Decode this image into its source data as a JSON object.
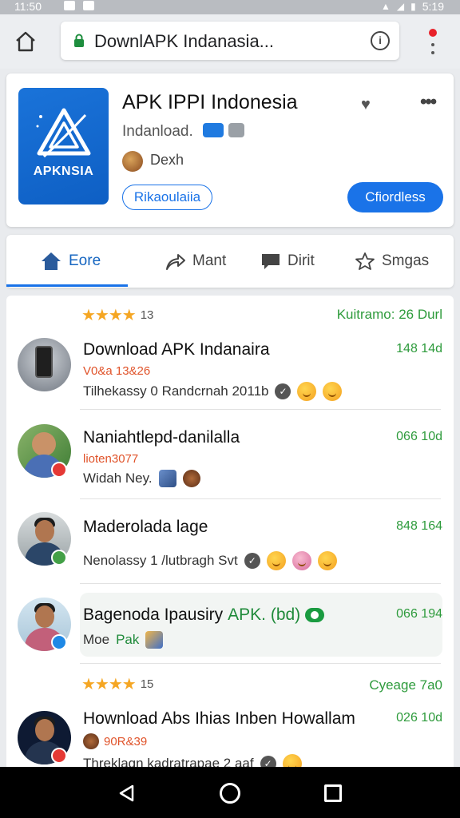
{
  "status_bar": {
    "time": "11:50",
    "right_time": "5:19"
  },
  "browser": {
    "url": "DownlAPK Indanasia..."
  },
  "app": {
    "title": "APK IPPI Indonesia",
    "logo_text": "APKNSIA",
    "subtitle": "Indanload.",
    "developer": "Dexh",
    "outline_button": "Rikaoulaiia",
    "primary_button": "Cfiordless"
  },
  "tabs": [
    {
      "label": "Eore",
      "icon": "home-icon"
    },
    {
      "label": "Mant",
      "icon": "share-icon"
    },
    {
      "label": "Dirit",
      "icon": "comment-icon"
    },
    {
      "label": "Smgas",
      "icon": "star-icon"
    }
  ],
  "feed": {
    "header": {
      "rating": "★★★★",
      "count": "13",
      "right": "Kuitramo: 26 Durl"
    },
    "items": [
      {
        "title": "Download APK Indanaira",
        "meta": "V0&a 13&26",
        "line": "Tilhekassy 0 Randcrnah 2011b",
        "stat": "148 14d"
      },
      {
        "title": "Naniahtlepd-danilalla",
        "meta": "lioten3077",
        "line": "Widah Ney.",
        "stat": "066 10d"
      },
      {
        "title": "Maderolada lage",
        "line": "Nenolassy 1 /lutbragh Svt",
        "stat": "848 164"
      },
      {
        "title": "Bagenoda Ipausiry",
        "title_green": "APK. (bd)",
        "line_a": "Moe",
        "line_b": "Pak",
        "stat": "066 194"
      }
    ],
    "header2": {
      "rating": "★★★★",
      "count": "15",
      "right": "Cyeage 7a0"
    },
    "last_item": {
      "title": "Hownload Abs Ihias Inben Howallam",
      "meta": "90R&39",
      "line": "Threklagn kadratrapae 2 aaf",
      "stat": "026 10d"
    }
  },
  "colors": {
    "accent": "#1a73e8",
    "stat_green": "#2e9b3c",
    "star": "#f5a623"
  }
}
